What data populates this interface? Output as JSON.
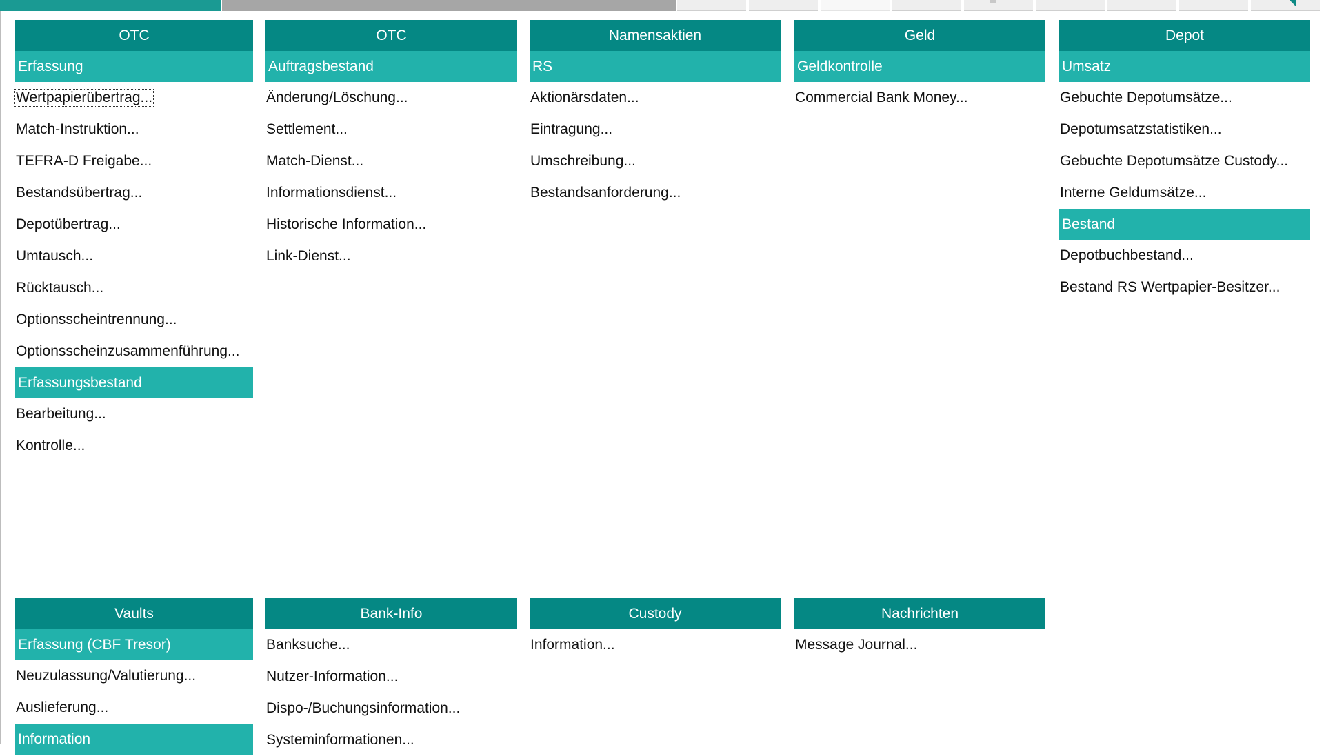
{
  "colors": {
    "header_bg": "#058884",
    "section_bg": "#22b2ab",
    "tab_active": "#1a9a93",
    "tab_inactive": "#a6a6a6"
  },
  "top_columns": [
    {
      "header": "OTC",
      "sections": [
        {
          "title": "Erfassung",
          "items": [
            "Wertpapierübertrag...",
            "Match-Instruktion...",
            "TEFRA-D Freigabe...",
            "Bestandsübertrag...",
            "Depotübertrag...",
            "Umtausch...",
            "Rücktausch...",
            "Optionsscheintrennung...",
            "Optionsscheinzusammenführung..."
          ]
        },
        {
          "title": "Erfassungsbestand",
          "items": [
            "Bearbeitung...",
            "Kontrolle..."
          ]
        }
      ]
    },
    {
      "header": "OTC",
      "sections": [
        {
          "title": "Auftragsbestand",
          "items": [
            "Änderung/Löschung...",
            "Settlement...",
            "Match-Dienst...",
            "Informationsdienst...",
            "Historische Information...",
            "Link-Dienst..."
          ]
        }
      ]
    },
    {
      "header": "Namensaktien",
      "sections": [
        {
          "title": "RS",
          "items": [
            "Aktionärsdaten...",
            "Eintragung...",
            "Umschreibung...",
            "Bestandsanforderung..."
          ]
        }
      ]
    },
    {
      "header": "Geld",
      "sections": [
        {
          "title": "Geldkontrolle",
          "items": [
            "Commercial Bank Money..."
          ]
        }
      ]
    },
    {
      "header": "Depot",
      "sections": [
        {
          "title": "Umsatz",
          "items": [
            "Gebuchte Depotumsätze...",
            "Depotumsatzstatistiken...",
            "Gebuchte Depotumsätze Custody...",
            "Interne Geldumsätze..."
          ]
        },
        {
          "title": "Bestand",
          "items": [
            "Depotbuchbestand...",
            "Bestand RS Wertpapier-Besitzer..."
          ]
        }
      ]
    }
  ],
  "bottom_columns": [
    {
      "header": "Vaults",
      "sections": [
        {
          "title": "Erfassung (CBF Tresor)",
          "items": [
            "Neuzulassung/Valutierung...",
            "Auslieferung..."
          ]
        },
        {
          "title": "Information",
          "items": []
        }
      ]
    },
    {
      "header": "Bank-Info",
      "sections": [
        {
          "title": "",
          "items": [
            "Banksuche...",
            "Nutzer-Information...",
            "Dispo-/Buchungsinformation...",
            "Systeminformationen..."
          ]
        }
      ]
    },
    {
      "header": "Custody",
      "sections": [
        {
          "title": "",
          "items": [
            "Information..."
          ]
        }
      ]
    },
    {
      "header": "Nachrichten",
      "sections": [
        {
          "title": "",
          "items": [
            "Message Journal..."
          ]
        }
      ]
    }
  ]
}
